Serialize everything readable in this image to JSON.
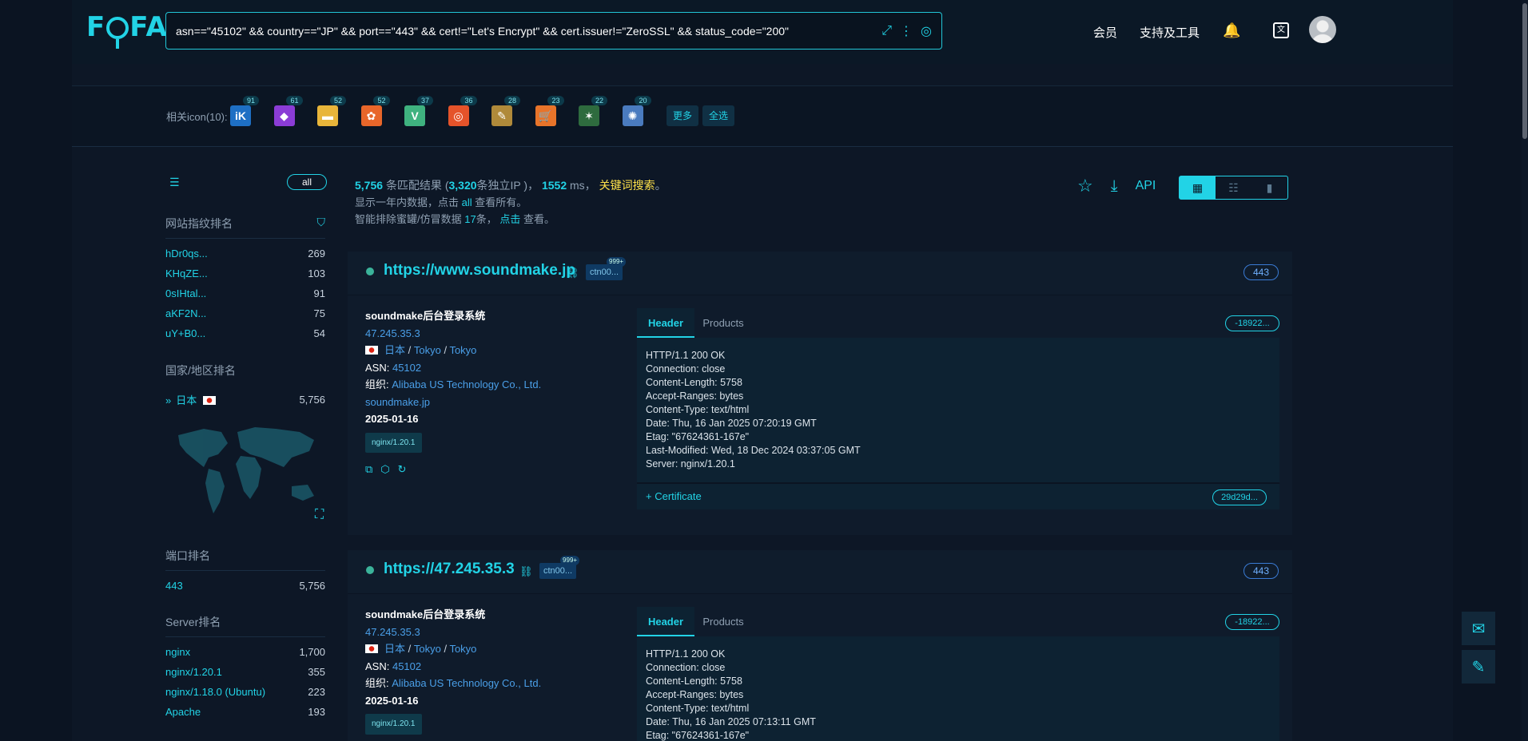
{
  "app": {
    "logo": "FOFA"
  },
  "search": {
    "query": "asn==\"45102\" && country==\"JP\" && port==\"443\" && cert!=\"Let's Encrypt\" && cert.issuer!=\"ZeroSSL\" && status_code=\"200\""
  },
  "nav": {
    "member": "会员",
    "tools": "支持及工具"
  },
  "icons_row": {
    "label": "相关icon(10):",
    "items": [
      {
        "glyph": "iK",
        "count": "91",
        "color": "#1e6fc4"
      },
      {
        "glyph": "◆",
        "count": "61",
        "color": "#8b3cd6"
      },
      {
        "glyph": "▬",
        "count": "52",
        "color": "#e8b53a"
      },
      {
        "glyph": "✿",
        "count": "52",
        "color": "#e8662a"
      },
      {
        "glyph": "V",
        "count": "37",
        "color": "#3fb27f"
      },
      {
        "glyph": "◎",
        "count": "36",
        "color": "#e5532a"
      },
      {
        "glyph": "✎",
        "count": "28",
        "color": "#b08a3a"
      },
      {
        "glyph": "🛒",
        "count": "23",
        "color": "#e8742a"
      },
      {
        "glyph": "✶",
        "count": "22",
        "color": "#2e6b3e"
      },
      {
        "glyph": "✺",
        "count": "20",
        "color": "#4a7bbf"
      }
    ],
    "more": "更多",
    "select_all": "全选"
  },
  "sidebar": {
    "all_label": "all",
    "fingerprint": {
      "title": "网站指纹排名",
      "items": [
        {
          "k": "hDr0qs...",
          "v": "269"
        },
        {
          "k": "KHqZE...",
          "v": "103"
        },
        {
          "k": "0sIHtal...",
          "v": "91"
        },
        {
          "k": "aKF2N...",
          "v": "75"
        },
        {
          "k": "uY+B0...",
          "v": "54"
        }
      ]
    },
    "country": {
      "title": "国家/地区排名",
      "item": {
        "k": "日本",
        "v": "5,756"
      }
    },
    "port": {
      "title": "端口排名",
      "items": [
        {
          "k": "443",
          "v": "5,756"
        }
      ]
    },
    "server": {
      "title": "Server排名",
      "items": [
        {
          "k": "nginx",
          "v": "1,700"
        },
        {
          "k": "nginx/1.20.1",
          "v": "355"
        },
        {
          "k": "nginx/1.18.0 (Ubuntu)",
          "v": "223"
        },
        {
          "k": "Apache",
          "v": "193"
        }
      ]
    }
  },
  "results": {
    "total": "5,756",
    "t1": "条匹配结果 (",
    "ips": "3,320",
    "t2": "条独立IP )，",
    "ms": "1552",
    "t3": "ms，",
    "keyword": "关键词搜索",
    "t4": "。",
    "line2a": "显示一年内数据，点击",
    "line2b": "all",
    "line2c": "查看所有。",
    "line3a": "智能排除蜜罐/仿冒数据",
    "line3b": "17",
    "line3c": "条，",
    "line3d": "点击",
    "line3e": "查看。",
    "api": "API"
  },
  "cards": [
    {
      "url": "https://www.soundmake.jp",
      "tag": "ctn00...",
      "tag_badge": "999+",
      "port": "443",
      "title": "soundmake后台登录系统",
      "ip": "47.245.35.3",
      "country": "日本",
      "region": "Tokyo",
      "city": "Tokyo",
      "asn_label": "ASN:",
      "asn": "45102",
      "org_label": "组织:",
      "org": "Alibaba US Technology Co., Ltd.",
      "domain": "soundmake.jp",
      "date": "2025-01-16",
      "server": "nginx/1.20.1",
      "tab_header": "Header",
      "tab_products": "Products",
      "hash": "-18922...",
      "header": "HTTP/1.1 200 OK\nConnection: close\nContent-Length: 5758\nAccept-Ranges: bytes\nContent-Type: text/html\nDate: Thu, 16 Jan 2025 07:20:19 GMT\nEtag: \"67624361-167e\"\nLast-Modified: Wed, 18 Dec 2024 03:37:05 GMT\nServer: nginx/1.20.1",
      "cert": "Certificate",
      "cert_hash": "29d29d..."
    },
    {
      "url": "https://47.245.35.3",
      "tag": "ctn00...",
      "tag_badge": "999+",
      "port": "443",
      "title": "soundmake后台登录系统",
      "ip": "47.245.35.3",
      "country": "日本",
      "region": "Tokyo",
      "city": "Tokyo",
      "asn_label": "ASN:",
      "asn": "45102",
      "org_label": "组织:",
      "org": "Alibaba US Technology Co., Ltd.",
      "date": "2025-01-16",
      "server": "nginx/1.20.1",
      "tab_header": "Header",
      "tab_products": "Products",
      "hash": "-18922...",
      "header": "HTTP/1.1 200 OK\nConnection: close\nContent-Length: 5758\nAccept-Ranges: bytes\nContent-Type: text/html\nDate: Thu, 16 Jan 2025 07:13:11 GMT\nEtag: \"67624361-167e\""
    }
  ]
}
